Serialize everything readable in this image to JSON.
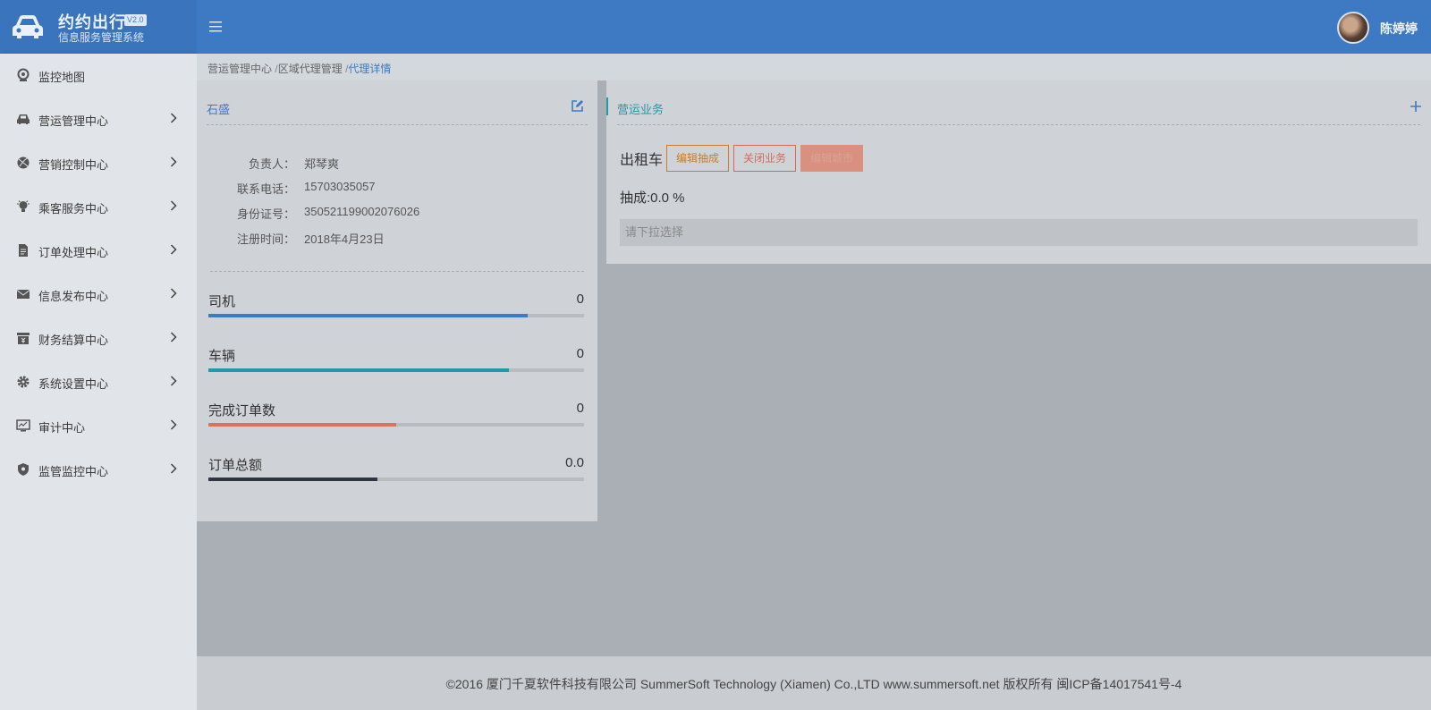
{
  "brand": {
    "name": "约约出行",
    "version": "V2.0",
    "subtitle": "信息服务管理系统"
  },
  "header": {
    "menu_icon": "hamburger-icon",
    "user_name": "陈婷婷"
  },
  "sidebar": {
    "items": [
      {
        "label": "监控地图",
        "icon": "map-pin-icon",
        "has_children": false
      },
      {
        "label": "营运管理中心",
        "icon": "car-icon",
        "has_children": true
      },
      {
        "label": "营销控制中心",
        "icon": "ball-icon",
        "has_children": true
      },
      {
        "label": "乘客服务中心",
        "icon": "bulb-icon",
        "has_children": true
      },
      {
        "label": "订单处理中心",
        "icon": "document-icon",
        "has_children": true
      },
      {
        "label": "信息发布中心",
        "icon": "mail-icon",
        "has_children": true
      },
      {
        "label": "财务结算中心",
        "icon": "yuan-icon",
        "has_children": true
      },
      {
        "label": "系统设置中心",
        "icon": "gear-icon",
        "has_children": true
      },
      {
        "label": "审计中心",
        "icon": "monitor-icon",
        "has_children": true
      },
      {
        "label": "监管监控中心",
        "icon": "shield-icon",
        "has_children": true
      }
    ]
  },
  "breadcrumb": {
    "items": [
      "营运管理中心",
      "区域代理管理"
    ],
    "current": "代理详情",
    "separator": "/"
  },
  "agent": {
    "name": "石盛",
    "fields": [
      {
        "label": "负责人：",
        "value": "郑琴爽"
      },
      {
        "label": "联系电话：",
        "value": "15703035057"
      },
      {
        "label": "身份证号：",
        "value": "350521199002076026"
      },
      {
        "label": "注册时间：",
        "value": "2018年4月23日"
      }
    ]
  },
  "stats": [
    {
      "label": "司机",
      "value": "0",
      "fill": 0.85,
      "color": "#3e7ac4"
    },
    {
      "label": "车辆",
      "value": "0",
      "fill": 0.8,
      "color": "#1e9aa8"
    },
    {
      "label": "完成订单数",
      "value": "0",
      "fill": 0.5,
      "color": "#d9745a"
    },
    {
      "label": "订单总额",
      "value": "0.0",
      "fill": 0.45,
      "color": "#2f3541"
    }
  ],
  "business": {
    "title": "营运业务",
    "service": "出租车",
    "buttons": {
      "edit_commission": "编辑抽成",
      "close_business": "关闭业务",
      "edit_city": "编辑城市"
    },
    "commission_text": "抽成:0.0 %",
    "select_placeholder": "请下拉选择"
  },
  "footer": {
    "text": "©2016 厦门千夏软件科技有限公司 SummerSoft Technology (Xiamen) Co.,LTD www.summersoft.net 版权所有 闽ICP备14017541号-4"
  },
  "colors": {
    "primary": "#3e7ac4",
    "teal": "#1e9aa8",
    "orange": "#c87d2a",
    "red": "#d26a5c"
  }
}
